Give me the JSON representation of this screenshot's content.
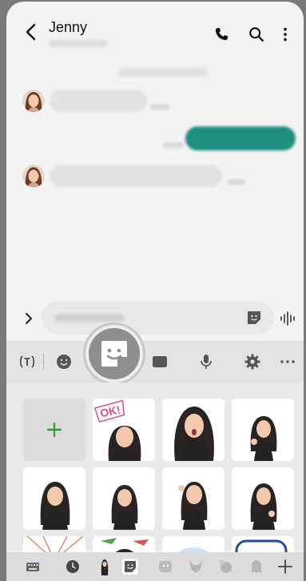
{
  "header": {
    "contact_name": "Jenny"
  },
  "icons": {
    "back": "chevron-left-icon",
    "call": "phone-icon",
    "search": "search-icon",
    "more": "more-vertical-icon",
    "expand": "chevron-right-icon",
    "sticker": "sticker-icon",
    "voice": "voice-wave-icon",
    "translate": "translate-icon",
    "emoji": "emoji-icon",
    "gif": "gif-icon",
    "mic": "microphone-icon",
    "settings": "gear-icon",
    "overflow": "more-horizontal-icon",
    "add": "plus-icon",
    "keyboard": "keyboard-icon",
    "recent": "clock-icon"
  },
  "sticker_panel": {
    "first_sticker_text": "OK!"
  },
  "colors": {
    "accent": "#1f8f80",
    "add_plus": "#3a9a3a",
    "spotlight": "#8e8e8e"
  }
}
